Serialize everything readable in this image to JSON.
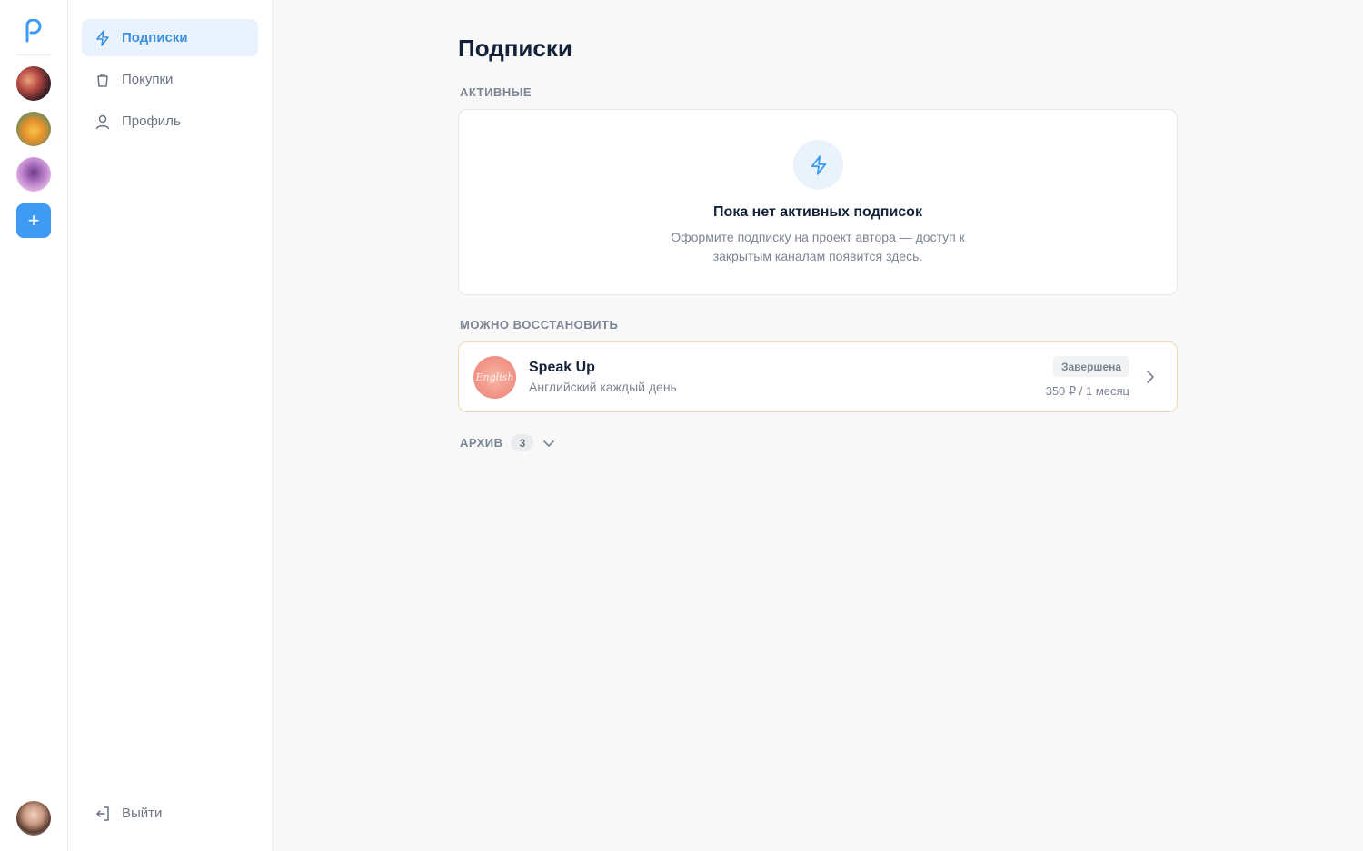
{
  "nav": {
    "items": [
      {
        "label": "Подписки",
        "icon": "lightning-icon",
        "active": true
      },
      {
        "label": "Покупки",
        "icon": "trash-bag-icon",
        "active": false
      },
      {
        "label": "Профиль",
        "icon": "user-icon",
        "active": false
      }
    ],
    "logout_label": "Выйти"
  },
  "rail": {
    "add_label": "+"
  },
  "page": {
    "title": "Подписки"
  },
  "active_section": {
    "label": "АКТИВНЫЕ",
    "empty_title": "Пока нет активных подписок",
    "empty_description": "Оформите подписку на проект автора — доступ к закрытым каналам появится здесь."
  },
  "restore_section": {
    "label": "МОЖНО ВОССТАНОВИТЬ",
    "items": [
      {
        "name": "Speak Up",
        "description": "Английский каждый день",
        "status": "Завершена",
        "price": "350 ₽ / 1 месяц",
        "avatar_text": "English"
      }
    ]
  },
  "archive": {
    "label": "АРХИВ",
    "count": "3"
  },
  "colors": {
    "accent": "#3d9bf3",
    "active_nav_bg": "#e9f3fd",
    "restore_border": "#f0d9b3"
  }
}
